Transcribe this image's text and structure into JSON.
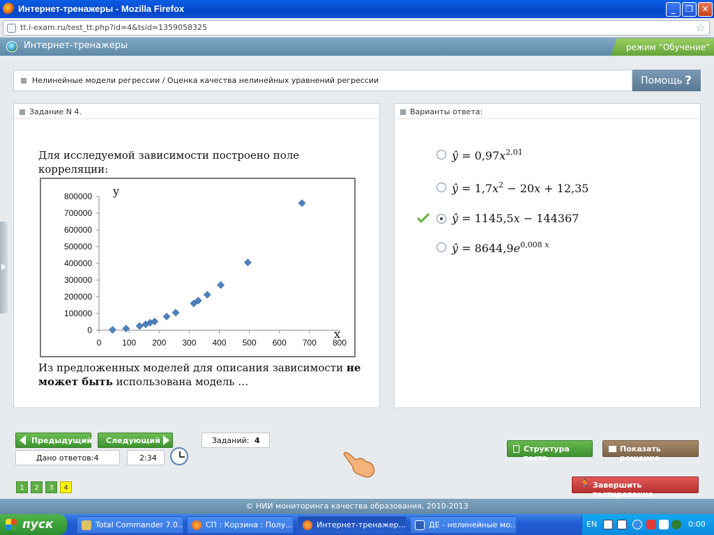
{
  "window": {
    "title": "Интернет-тренажеры - Mozilla Firefox",
    "min": "_",
    "max": "❐",
    "close": "✕"
  },
  "browser": {
    "url": "tt.i-exam.ru/test_tt.php?id=4&tsid=1359058325",
    "star": "☆"
  },
  "app": {
    "name": "Интернет-тренажеры",
    "mode": "режим “Обучение”"
  },
  "breadcrumb": {
    "text": "Нелинейные модели регрессии / Оценка качества нелинейных уравнений регрессии",
    "help": "Помощь",
    "help_icon": "?"
  },
  "task": {
    "header": "Задание N 4.",
    "intro_line1": "Для исследуемой зависимости построено поле",
    "intro_line2": "корреляции:",
    "outro_line1_a": "Из предложенных моделей для описания зависимости ",
    "outro_line1_b": "не",
    "outro_line2_a": "может быть",
    "outro_line2_b": " использована модель …"
  },
  "chart_data": {
    "type": "scatter",
    "xlabel": "x",
    "ylabel": "y",
    "xlim": [
      0,
      800
    ],
    "ylim": [
      0,
      800000
    ],
    "xticks": [
      "0",
      "100",
      "200",
      "300",
      "400",
      "500",
      "600",
      "700",
      "800"
    ],
    "yticks": [
      "0",
      "100000",
      "200000",
      "300000",
      "400000",
      "500000",
      "600000",
      "700000",
      "800000"
    ],
    "grid": false,
    "points": [
      {
        "x": 45,
        "y": 2000
      },
      {
        "x": 90,
        "y": 10000
      },
      {
        "x": 135,
        "y": 25000
      },
      {
        "x": 155,
        "y": 35000
      },
      {
        "x": 170,
        "y": 45000
      },
      {
        "x": 185,
        "y": 52000
      },
      {
        "x": 225,
        "y": 82000
      },
      {
        "x": 255,
        "y": 105000
      },
      {
        "x": 315,
        "y": 160000
      },
      {
        "x": 330,
        "y": 177000
      },
      {
        "x": 360,
        "y": 212000
      },
      {
        "x": 405,
        "y": 270000
      },
      {
        "x": 495,
        "y": 405000
      },
      {
        "x": 675,
        "y": 760000
      }
    ],
    "marker_color": "#4f81bd"
  },
  "answers": {
    "header": "Варианты ответа:",
    "selected_index": 2
  },
  "nav": {
    "prev": "Предыдущий",
    "next": "Следующий",
    "tasks_label": "Заданий:",
    "tasks_count": "4",
    "answers_given": "Дано ответов:4",
    "time": "2:34",
    "pages": [
      "1",
      "2",
      "3",
      "4"
    ],
    "current_page": "4",
    "structure": "Структура теста",
    "show_solution": "Показать решение",
    "finish": "Завершить тестирование"
  },
  "footer": {
    "text": "© НИИ мониторинга качества образования, 2010-2013"
  },
  "taskbar": {
    "start": "пуск",
    "tasks": [
      "Total Commander 7.0...",
      "СП : Корзина : Полу...",
      "Интернет-тренажер...",
      "ДЕ - нелинейные мо..."
    ],
    "lang": "EN",
    "clock": "0:00"
  },
  "colors": {
    "accent_green": "#4aa43a",
    "header_blue": "#6a92b0",
    "marker": "#4f81bd"
  }
}
